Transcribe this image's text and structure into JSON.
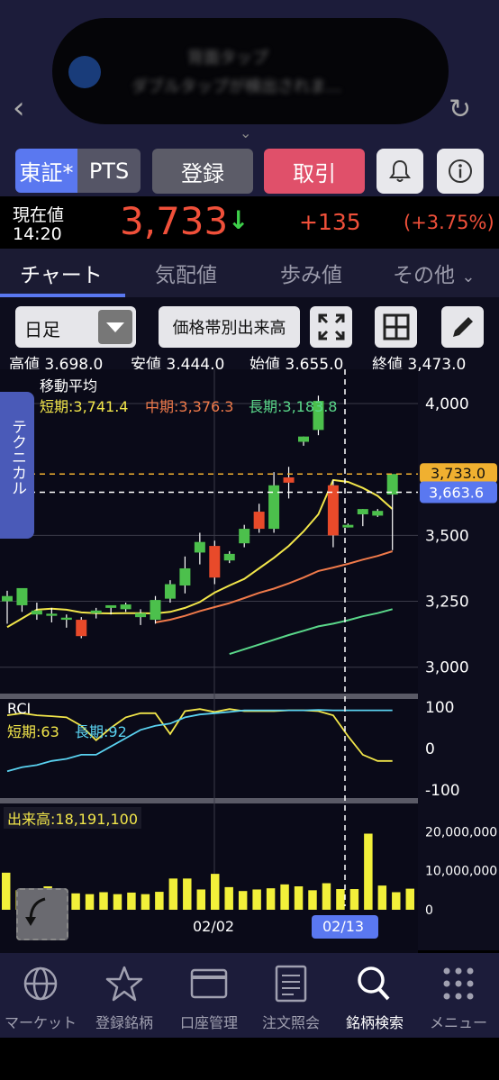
{
  "notification": {
    "title": "背面タップ",
    "message": "ダブルタップが検出されま..."
  },
  "toolbar": {
    "exchange_tse": "東証*",
    "exchange_pts": "PTS",
    "register": "登録",
    "trade": "取引"
  },
  "quote": {
    "label_current": "現在値",
    "time": "14:20",
    "price": "3,733",
    "arrow": "↓",
    "change": "+135",
    "change_pct": "(+3.75%)"
  },
  "tabs": [
    {
      "label": "チャート",
      "active": true
    },
    {
      "label": "気配値",
      "active": false
    },
    {
      "label": "歩み値",
      "active": false
    },
    {
      "label": "その他",
      "active": false
    }
  ],
  "chart_controls": {
    "period": "日足",
    "volume_by_price": "価格帯別出来高"
  },
  "ohlc": {
    "high": "高値 3,698.0",
    "low": "安値 3,444.0",
    "open": "始値 3,655.0",
    "close": "終値 3,473.0"
  },
  "side_tab": "テクニカル",
  "moving_average": {
    "title": "移動平均",
    "short": "短期:3,741.4",
    "mid": "中期:3,376.3",
    "long": "長期:3,183.8"
  },
  "rci": {
    "title": "RCI",
    "short": "短期:63",
    "long": "長期:92"
  },
  "volume": {
    "title": "出来高:18,191,100"
  },
  "colors": {
    "up": "#4cc04c",
    "down": "#e84a2a",
    "ma_short": "#f2e64a",
    "ma_mid": "#f07a4a",
    "ma_long": "#5ad88a",
    "rci_long": "#5ad2f0",
    "accent": "#5a78f0"
  },
  "chart_data": [
    {
      "type": "candlestick",
      "title": "",
      "ylim": [
        2900,
        4130
      ],
      "y_ticks": [
        "4,000",
        "3,500",
        "3,250",
        "3,000"
      ],
      "price_tags": [
        "3,733.0",
        "3,663.6"
      ],
      "candles": [
        {
          "o": 3250,
          "h": 3290,
          "l": 3165,
          "c": 3270
        },
        {
          "o": 3235,
          "h": 3265,
          "l": 3210,
          "c": 3300
        },
        {
          "o": 3200,
          "h": 3245,
          "l": 3180,
          "c": 3215
        },
        {
          "o": 3195,
          "h": 3225,
          "l": 3170,
          "c": 3203
        },
        {
          "o": 3180,
          "h": 3200,
          "l": 3150,
          "c": 3188
        },
        {
          "o": 3180,
          "h": 3190,
          "l": 3110,
          "c": 3118
        },
        {
          "o": 3205,
          "h": 3225,
          "l": 3185,
          "c": 3215
        },
        {
          "o": 3225,
          "h": 3230,
          "l": 3200,
          "c": 3235
        },
        {
          "o": 3220,
          "h": 3245,
          "l": 3210,
          "c": 3238
        },
        {
          "o": 3190,
          "h": 3220,
          "l": 3160,
          "c": 3205
        },
        {
          "o": 3180,
          "h": 3270,
          "l": 3165,
          "c": 3255
        },
        {
          "o": 3260,
          "h": 3330,
          "l": 3245,
          "c": 3315
        },
        {
          "o": 3310,
          "h": 3420,
          "l": 3280,
          "c": 3375
        },
        {
          "o": 3435,
          "h": 3510,
          "l": 3390,
          "c": 3475
        },
        {
          "o": 3460,
          "h": 3480,
          "l": 3315,
          "c": 3340
        },
        {
          "o": 3405,
          "h": 3440,
          "l": 3395,
          "c": 3430
        },
        {
          "o": 3470,
          "h": 3540,
          "l": 3455,
          "c": 3525
        },
        {
          "o": 3590,
          "h": 3620,
          "l": 3510,
          "c": 3525
        },
        {
          "o": 3525,
          "h": 3740,
          "l": 3510,
          "c": 3690
        },
        {
          "o": 3720,
          "h": 3760,
          "l": 3640,
          "c": 3700
        },
        {
          "o": 3855,
          "h": 3875,
          "l": 3840,
          "c": 3875
        },
        {
          "o": 3900,
          "h": 4030,
          "l": 3880,
          "c": 4010
        },
        {
          "o": 3690,
          "h": 3710,
          "l": 3455,
          "c": 3500
        },
        {
          "o": 3530,
          "h": 3545,
          "l": 3530,
          "c": 3540
        },
        {
          "o": 3580,
          "h": 3600,
          "l": 3535,
          "c": 3600
        },
        {
          "o": 3575,
          "h": 3600,
          "l": 3570,
          "c": 3593
        },
        {
          "o": 3655,
          "h": 3698,
          "l": 3444,
          "c": 3733
        }
      ],
      "ma_short": [
        3152,
        3185,
        3218,
        3222,
        3218,
        3208,
        3205,
        3204,
        3205,
        3205,
        3204,
        3210,
        3225,
        3247,
        3283,
        3310,
        3335,
        3375,
        3415,
        3460,
        3515,
        3580,
        3710,
        3703,
        3680,
        3650,
        3600
      ],
      "ma_mid": [
        null,
        null,
        null,
        null,
        null,
        null,
        null,
        null,
        null,
        null,
        3170,
        3180,
        3195,
        3213,
        3228,
        3243,
        3262,
        3282,
        3298,
        3318,
        3340,
        3365,
        3378,
        3392,
        3408,
        3422,
        3440
      ],
      "ma_long": [
        null,
        null,
        null,
        null,
        null,
        null,
        null,
        null,
        null,
        null,
        null,
        null,
        null,
        null,
        null,
        3050,
        3068,
        3086,
        3104,
        3122,
        3138,
        3155,
        3165,
        3178,
        3193,
        3205,
        3220
      ]
    },
    {
      "type": "line",
      "title": "RCI",
      "ylim": [
        -115,
        115
      ],
      "y_ticks": [
        "100",
        "0",
        "-100"
      ],
      "series": [
        {
          "name": "短期",
          "values": [
            80,
            85,
            80,
            78,
            75,
            55,
            20,
            50,
            75,
            85,
            85,
            35,
            90,
            95,
            88,
            95,
            90,
            90,
            90,
            92,
            92,
            90,
            80,
            30,
            -15,
            -30,
            -30
          ]
        },
        {
          "name": "長期",
          "values": [
            -55,
            -45,
            -40,
            -30,
            -25,
            -15,
            -15,
            5,
            25,
            45,
            55,
            60,
            75,
            82,
            85,
            88,
            92,
            92,
            92,
            92,
            92,
            93,
            92,
            92,
            92,
            92,
            92
          ]
        }
      ]
    },
    {
      "type": "bar",
      "title": "出来高",
      "ylim": [
        0,
        24000000
      ],
      "y_ticks": [
        "20,000,000",
        "10,000,000",
        "0"
      ],
      "x_labels": [
        "02/02",
        "02/13"
      ],
      "values": [
        9500000,
        5000000,
        4500000,
        6000000,
        4000000,
        4200000,
        4000000,
        4500000,
        4000000,
        4400000,
        4000000,
        4600000,
        8000000,
        8000000,
        5200000,
        9200000,
        5800000,
        4800000,
        5200000,
        5500000,
        6500000,
        6000000,
        5000000,
        6800000,
        5300000,
        5300000,
        19500000,
        6200000,
        4500000,
        5400000
      ]
    }
  ],
  "bottom_nav": [
    {
      "label": "マーケット",
      "icon": "globe-icon",
      "active": false
    },
    {
      "label": "登録銘柄",
      "icon": "star-icon",
      "active": false
    },
    {
      "label": "口座管理",
      "icon": "card-icon",
      "active": false
    },
    {
      "label": "注文照会",
      "icon": "document-icon",
      "active": false
    },
    {
      "label": "銘柄検索",
      "icon": "search-icon",
      "active": true
    },
    {
      "label": "メニュー",
      "icon": "grid-menu-icon",
      "active": false
    }
  ]
}
